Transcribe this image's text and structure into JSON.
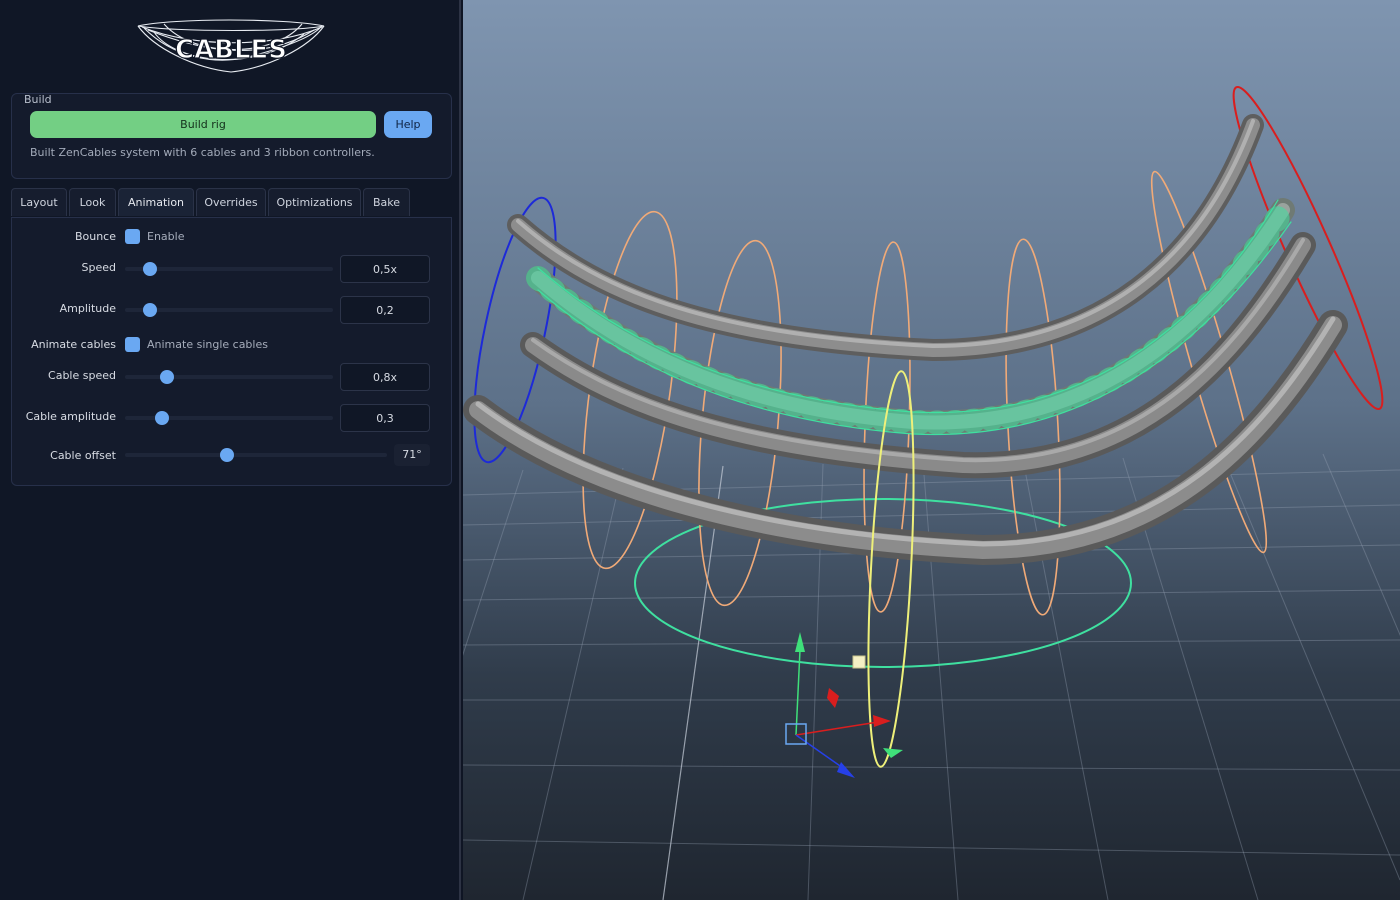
{
  "logo": {
    "text": "CABLES"
  },
  "build": {
    "title": "Build",
    "build_button": "Build rig",
    "help_button": "Help",
    "status": "Built ZenCables system with 6 cables and 3 ribbon controllers."
  },
  "tabs": [
    {
      "label": "Layout",
      "active": false
    },
    {
      "label": "Look",
      "active": false
    },
    {
      "label": "Animation",
      "active": true
    },
    {
      "label": "Overrides",
      "active": false
    },
    {
      "label": "Optimizations",
      "active": false
    },
    {
      "label": "Bake",
      "active": false
    }
  ],
  "animation": {
    "bounce": {
      "label": "Bounce",
      "checkbox_label": "Enable",
      "checked": true
    },
    "speed": {
      "label": "Speed",
      "value": "0,5x",
      "fraction": 0.12
    },
    "amplitude": {
      "label": "Amplitude",
      "value": "0,2",
      "fraction": 0.12
    },
    "animate_cables": {
      "label": "Animate cables",
      "checkbox_label": "Animate single cables",
      "checked": true
    },
    "cable_speed": {
      "label": "Cable speed",
      "value": "0,8x",
      "fraction": 0.2
    },
    "cable_amplitude": {
      "label": "Cable amplitude",
      "value": "0,3",
      "fraction": 0.18
    },
    "cable_offset": {
      "label": "Cable offset",
      "value": "71°",
      "fraction": 0.39
    }
  },
  "colors": {
    "accent": "#6aa8f2",
    "build_green": "#73cf84",
    "panel_bg": "#101726",
    "ribbon_controller": "#f0aa78",
    "selected_ribbon": "#3fe0a0",
    "start_controller": "#1d2ad8",
    "end_controller": "#d91e1e"
  }
}
